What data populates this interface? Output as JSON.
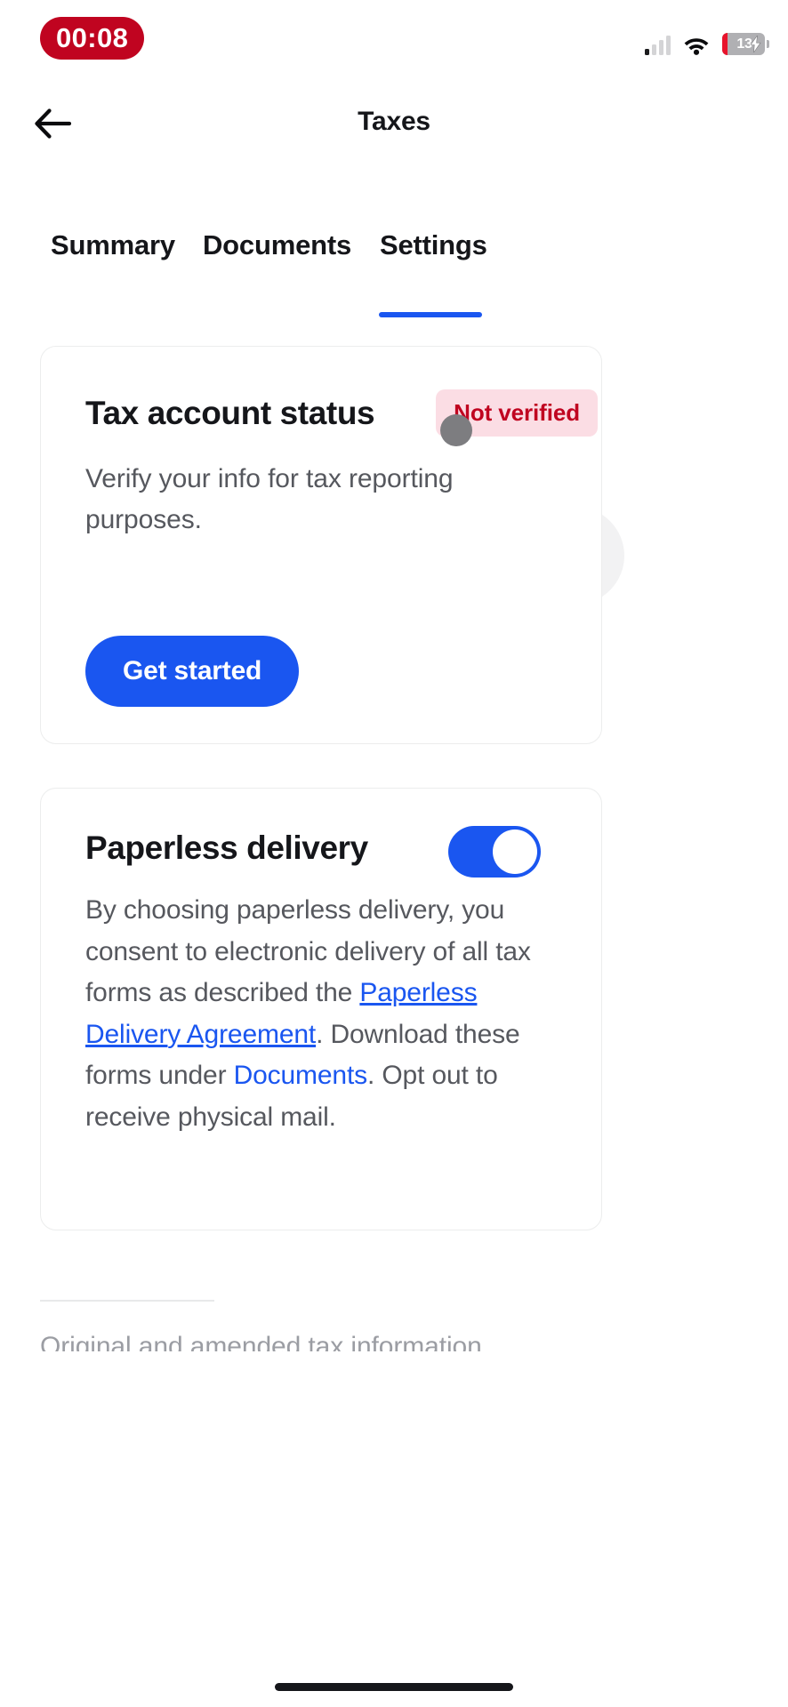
{
  "status_bar": {
    "timer": "00:08",
    "signal_icon": "cellular-signal-icon",
    "signal_bars_filled": 1,
    "signal_bars_total": 4,
    "wifi_icon": "wifi-icon",
    "battery_percent": "13",
    "battery_level": 13,
    "battery_charging": true,
    "timer_bg": "#c00420",
    "battery_fill_color": "#e8132b"
  },
  "header": {
    "title": "Taxes",
    "back_icon": "arrow-left-icon"
  },
  "tabs": {
    "items": [
      {
        "label": "Summary",
        "active": false
      },
      {
        "label": "Documents",
        "active": false
      },
      {
        "label": "Settings",
        "active": true
      }
    ],
    "active_index": 2,
    "indicator_color": "#1a56f0"
  },
  "tax_status_card": {
    "title": "Tax account status",
    "badge": "Not verified",
    "badge_bg": "#fbdde4",
    "badge_color": "#c00420",
    "description": "Verify your info for tax reporting purposes.",
    "cta_label": "Get started",
    "cta_bg": "#1a56f0"
  },
  "paperless_card": {
    "title": "Paperless delivery",
    "toggle_on": true,
    "toggle_color": "#1a56f0",
    "body_part1": "By choosing paperless delivery, you consent to electronic delivery of all tax forms as described the ",
    "link1": "Paperless Delivery Agreement",
    "body_part2": ". Download these forms under ",
    "link2": "Documents",
    "body_part3": ". Opt out to receive physical mail.",
    "link_color": "#1a56f0"
  },
  "bottom_section": {
    "partial_text": "Original and amended tax information"
  }
}
